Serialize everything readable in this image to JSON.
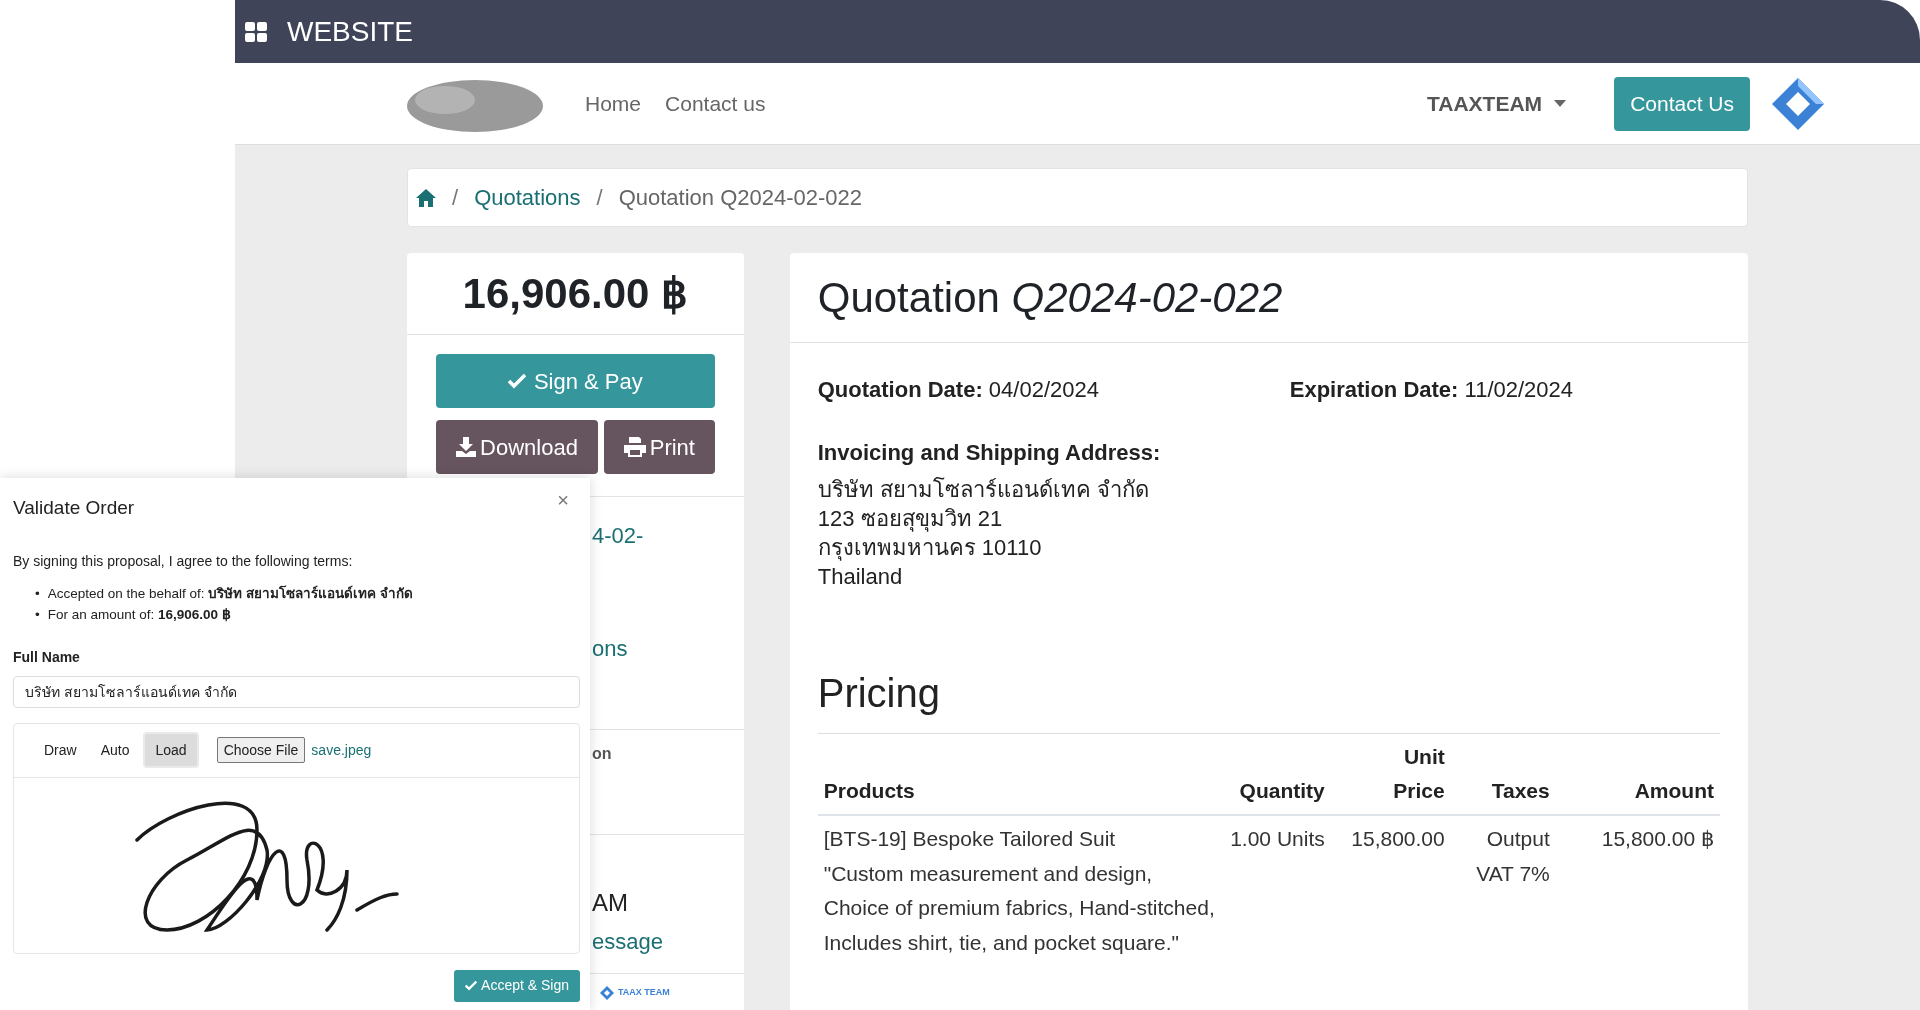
{
  "app_bar": {
    "title": "WEBSITE"
  },
  "navbar": {
    "links": [
      {
        "label": "Home"
      },
      {
        "label": "Contact us"
      }
    ],
    "user": "TAAXTEAM",
    "cta": "Contact Us"
  },
  "breadcrumb": [
    {
      "separator": "/",
      "label": "Quotations",
      "kind": "link"
    },
    {
      "separator": "/",
      "label": "Quotation Q2024-02-022",
      "kind": "current"
    }
  ],
  "sidebar": {
    "total": "16,906.00 ฿",
    "buttons": [
      {
        "label": "Sign & Pay",
        "kind": "primary"
      },
      {
        "label": "Download",
        "kind": "download"
      },
      {
        "label": "Print",
        "kind": "print"
      }
    ],
    "sections": [
      {
        "items": [
          {
            "text": "4-02-",
            "kind": "link"
          },
          {
            "text": "ons",
            "kind": "link"
          }
        ]
      },
      {
        "items": [
          {
            "text": "on",
            "kind": "label"
          }
        ]
      },
      {
        "items": [
          {
            "text": "AM",
            "kind": "text"
          },
          {
            "text": "essage",
            "kind": "link"
          }
        ]
      },
      {
        "items": [
          {
            "text": "TAAX TEAM",
            "kind": "logo"
          }
        ]
      }
    ]
  },
  "document": {
    "title": "Quotation *Q2024-02-022*",
    "dates": [
      {
        "label": "Quotation Date:",
        "value": "04/02/2024"
      },
      {
        "label": "Expiration Date:",
        "value": "11/02/2024"
      }
    ],
    "address_heading": "Invoicing and Shipping Address:",
    "address_lines": [
      "บริษัท สยามโซลาร์แอนด์เทค จำกัด",
      "123 ซอยสุขุมวิท 21",
      "กรุงเทพมหานคร 10110",
      "Thailand"
    ],
    "pricing_heading": "Pricing",
    "table": {
      "columns": [
        "Products",
        "Quantity",
        "Unit Price",
        "Taxes",
        "Amount"
      ],
      "rows": [
        [
          "[BTS-19] Bespoke Tailored Suit\n\"Custom measurement and design, Choice of premium fabrics, Hand-stitched, Includes shirt, tie, and pocket square.\"",
          "1.00 Units",
          "15,800.00",
          "Output VAT 7%",
          "15,800.00 ฿"
        ]
      ]
    }
  },
  "modal": {
    "title": "Validate Order",
    "close": "×",
    "intro": "By signing this proposal, I agree to the following terms:",
    "terms": [
      {
        "bullet": "•",
        "text": "Accepted on the behalf of: **บริษัท สยามโซลาร์แอนด์เทค จำกัด**"
      },
      {
        "bullet": "•",
        "text": "For an amount of: **16,906.00 ฿**"
      }
    ],
    "full_name_label": "Full Name",
    "full_name_value": "บริษัท สยามโซลาร์แอนด์เทค จำกัด",
    "tabs": [
      {
        "label": "Draw",
        "selected": false
      },
      {
        "label": "Auto",
        "selected": false
      },
      {
        "label": "Load",
        "selected": true
      }
    ],
    "file_button": "Choose File",
    "file_name": "save.jpeg",
    "submit": "Accept & Sign"
  }
}
